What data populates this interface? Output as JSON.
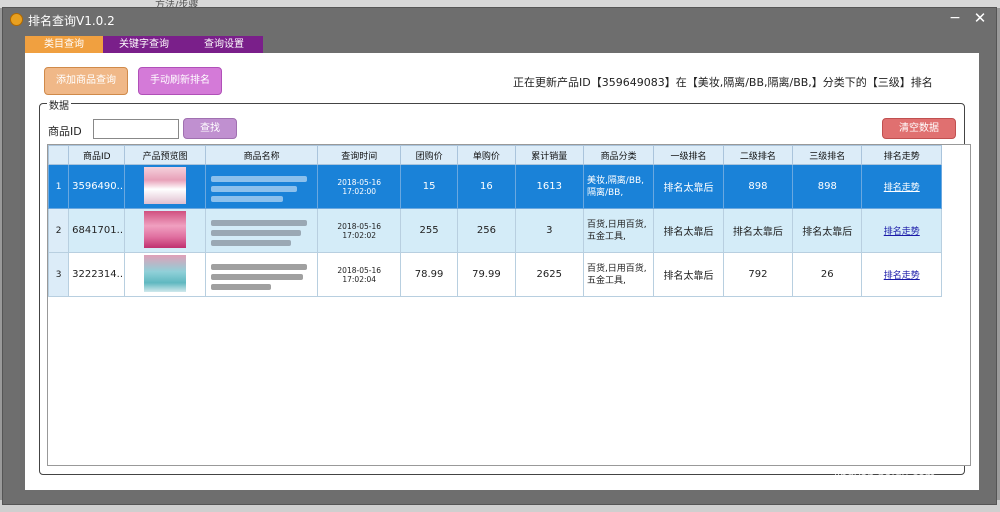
{
  "window": {
    "title": "排名查询V1.0.2",
    "background_tab_text": "方法/步骤"
  },
  "tabs": [
    {
      "label": "类目查询"
    },
    {
      "label": "关键字查询"
    },
    {
      "label": "查询设置"
    }
  ],
  "toolbar": {
    "add_label": "添加商品查询",
    "refresh_label": "手动刷新排名"
  },
  "status_text": "正在更新产品ID【359649083】在【美妆,隔离/BB,隔离/BB,】分类下的【三级】排名",
  "data_group": {
    "label": "数据",
    "product_id_label": "商品ID",
    "product_id_value": "",
    "find_label": "查找",
    "clear_label": "清空数据"
  },
  "table": {
    "columns": [
      "商品ID",
      "产品预览图",
      "商品名称",
      "查询时间",
      "团购价",
      "单购价",
      "累计销量",
      "商品分类",
      "一级排名",
      "二级排名",
      "三级排名",
      "排名走势"
    ],
    "rows": [
      {
        "num": "1",
        "id": "3596490...",
        "time": "2018-05-16 17:02:00",
        "group_price": "15",
        "single_price": "16",
        "sales": "1613",
        "cat1": "美妆,隔离/BB,",
        "cat2": "隔离/BB,",
        "rank1": "排名太靠后",
        "rank2": "898",
        "rank3": "898",
        "trend": "排名走势"
      },
      {
        "num": "2",
        "id": "6841701...",
        "time": "2018-05-16 17:02:02",
        "group_price": "255",
        "single_price": "256",
        "sales": "3",
        "cat1": "百货,日用百货,",
        "cat2": "五金工具,",
        "rank1": "排名太靠后",
        "rank2": "排名太靠后",
        "rank3": "排名太靠后",
        "trend": "排名走势"
      },
      {
        "num": "3",
        "id": "3222314...",
        "time": "2018-05-16 17:02:04",
        "group_price": "78.99",
        "single_price": "79.99",
        "sales": "2625",
        "cat1": "百货,日用百货,",
        "cat2": "五金工具,",
        "rank1": "排名太靠后",
        "rank2": "792",
        "rank3": "26",
        "trend": "排名走势"
      }
    ]
  },
  "icons": {
    "app": "app-icon",
    "minimize": "minimize-icon",
    "close": "close-icon"
  },
  "watermark": {
    "text": "Bai du 经验",
    "url": "jingyan.baidu.com"
  },
  "colors": {
    "tab_active": "#f0a040",
    "tab_inactive": "#7a1f8a",
    "selected_row": "#1a82d8",
    "alt_row": "#d4ecf8"
  }
}
